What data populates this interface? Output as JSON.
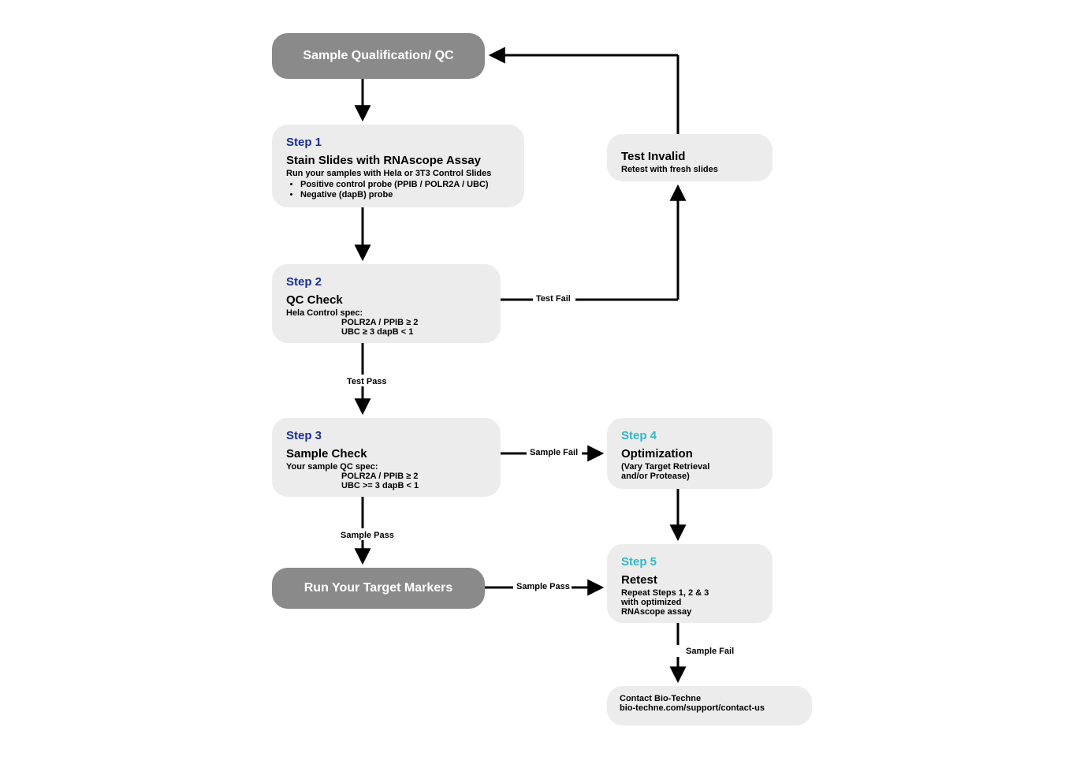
{
  "nodes": {
    "start": {
      "title": "Sample Qualification/ QC"
    },
    "step1": {
      "label": "Step 1",
      "title": "Stain Slides with RNAscope Assay",
      "sub": "Run your samples with Hela or 3T3 Control Slides",
      "bullets": [
        "Positive control probe (PPIB / POLR2A / UBC)",
        "Negative (dapB) probe"
      ]
    },
    "step2": {
      "label": "Step 2",
      "title": "QC Check",
      "sub": "Hela Control spec:",
      "spec1": "POLR2A / PPIB ≥ 2",
      "spec2": "UBC ≥ 3 dapB < 1"
    },
    "step3": {
      "label": "Step 3",
      "title": "Sample Check",
      "sub": "Your sample QC spec:",
      "spec1": "POLR2A / PPIB ≥ 2",
      "spec2": "UBC >= 3 dapB < 1"
    },
    "runTarget": {
      "title": "Run Your Target Markers"
    },
    "invalid": {
      "title": "Test Invalid",
      "sub": "Retest with fresh slides"
    },
    "step4": {
      "label": "Step 4",
      "title": "Optimization",
      "sub1": "(Vary Target Retrieval",
      "sub2": "and/or Protease)"
    },
    "step5": {
      "label": "Step 5",
      "title": "Retest",
      "sub1": "Repeat Steps 1, 2 & 3",
      "sub2": "with optimized",
      "sub3": "RNAscope assay"
    },
    "contact": {
      "line1": "Contact Bio-Techne",
      "line2": "bio-techne.com/support/contact-us"
    }
  },
  "edges": {
    "testPass": "Test Pass",
    "testFail": "Test Fail",
    "samplePass": "Sample Pass",
    "sampleFail": "Sample Fail",
    "samplePass2": "Sample Pass",
    "sampleFail2": "Sample Fail"
  }
}
